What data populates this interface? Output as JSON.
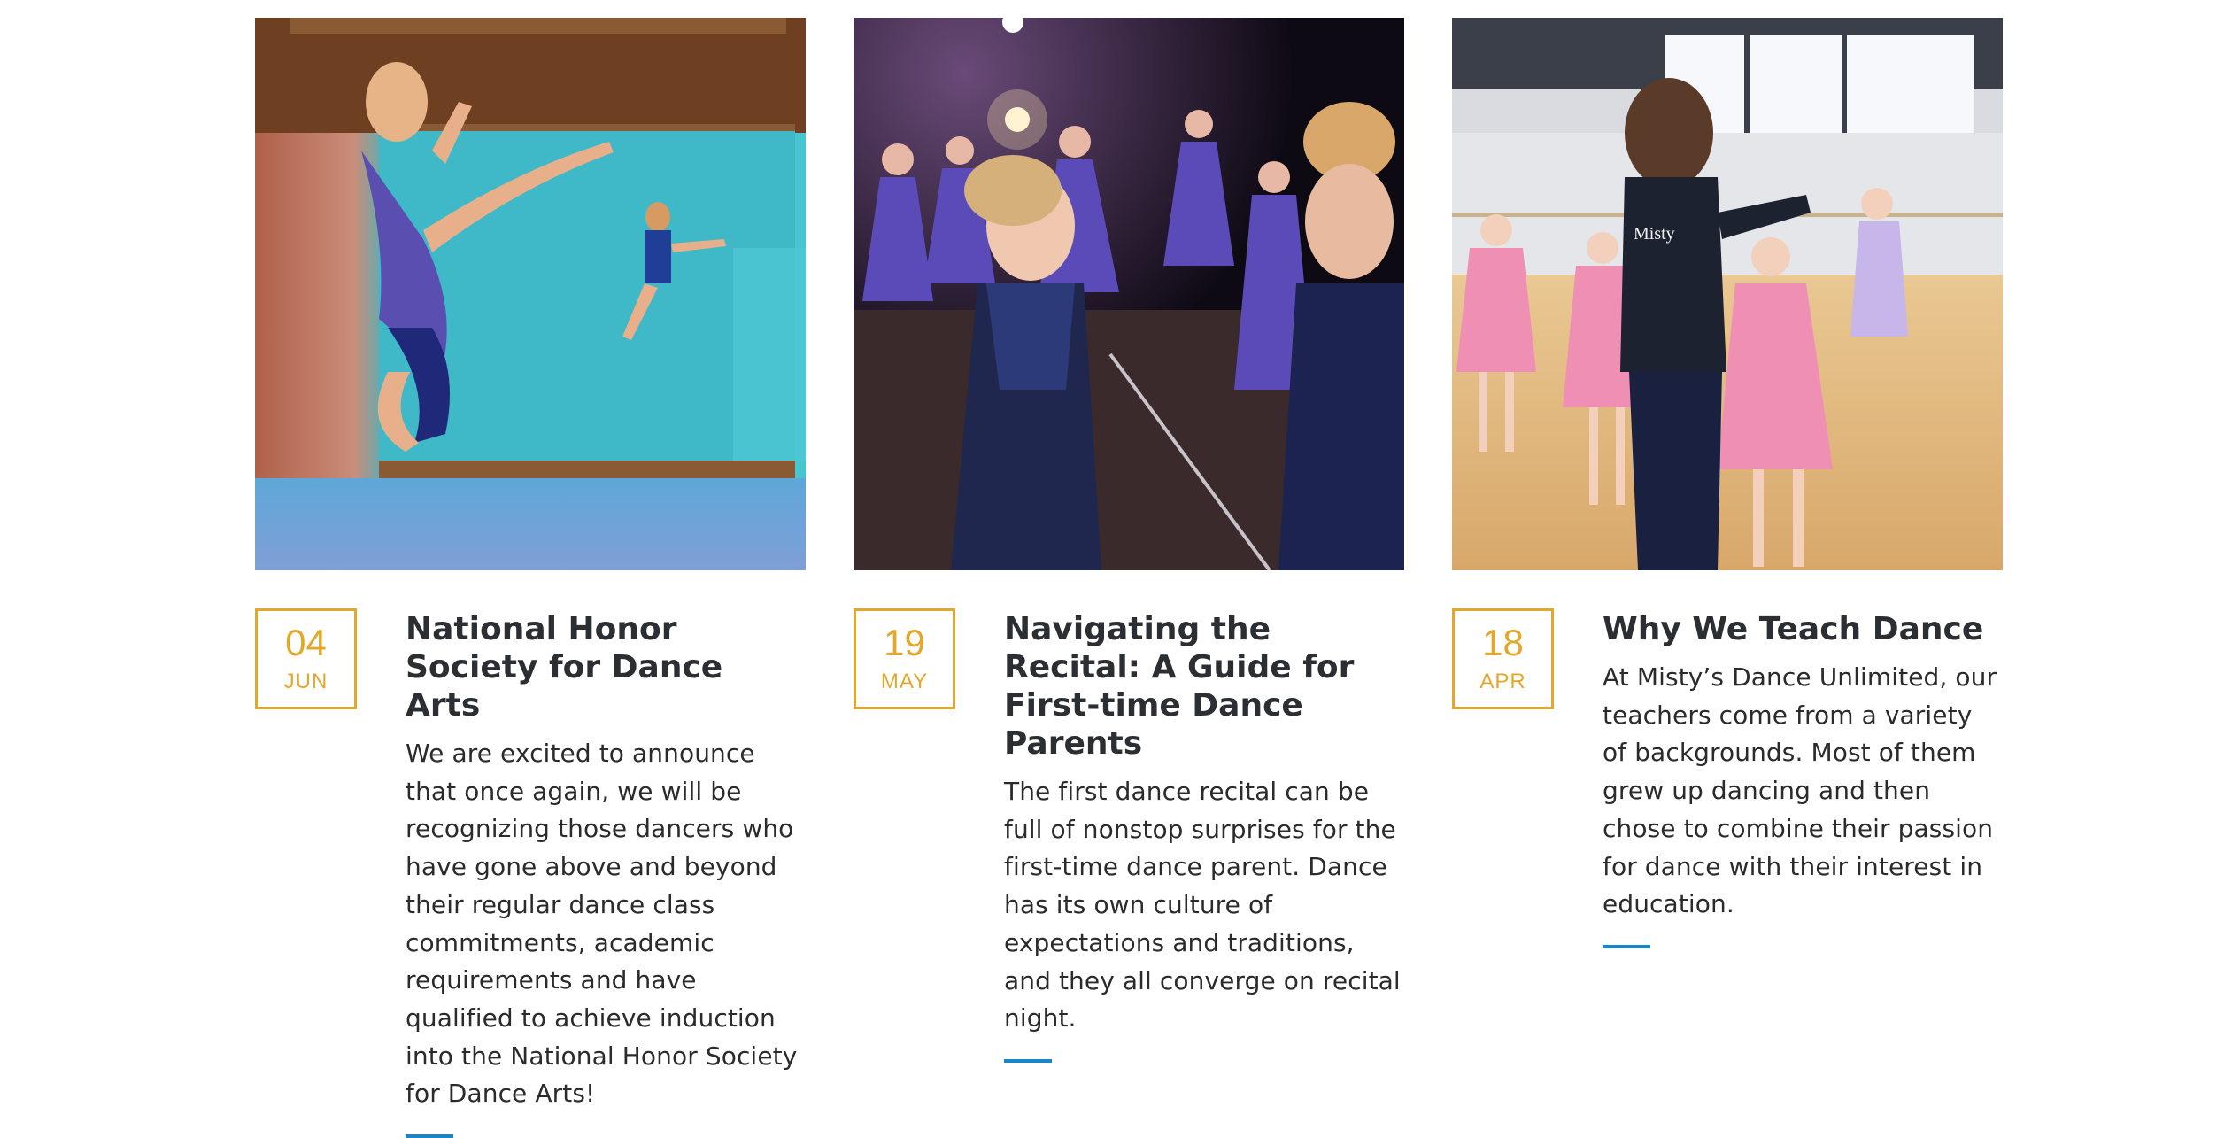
{
  "colors": {
    "accent_gold": "#e3a82b",
    "accent_blue": "#1a86c7",
    "title": "#2b2e33",
    "body": "#2b2b2b"
  },
  "posts": [
    {
      "image_icon": "dancers-leaping-photo",
      "day": "04",
      "month": "JUN",
      "title": "National Honor Society for Dance Arts",
      "excerpt": "We are excited to announce that once again, we will be recognizing those dancers who have gone above and beyond their regular dance class commitments, academic requirements and have qualified to achieve induction into the National Honor Society for Dance Arts!"
    },
    {
      "image_icon": "recital-dancers-photo",
      "day": "19",
      "month": "MAY",
      "title": "Navigating the Recital: A Guide for First-time Dance Parents",
      "excerpt": "The first dance recital can be full of nonstop surprises for the first-time dance parent. Dance has its own culture of expectations and traditions, and they all converge on recital night."
    },
    {
      "image_icon": "ballet-class-photo",
      "day": "18",
      "month": "APR",
      "title": "Why We Teach Dance",
      "excerpt": "At Misty’s Dance Unlimited, our teachers come from a variety of backgrounds. Most of them grew up dancing and then chose to combine their passion for dance with their interest in education."
    }
  ]
}
